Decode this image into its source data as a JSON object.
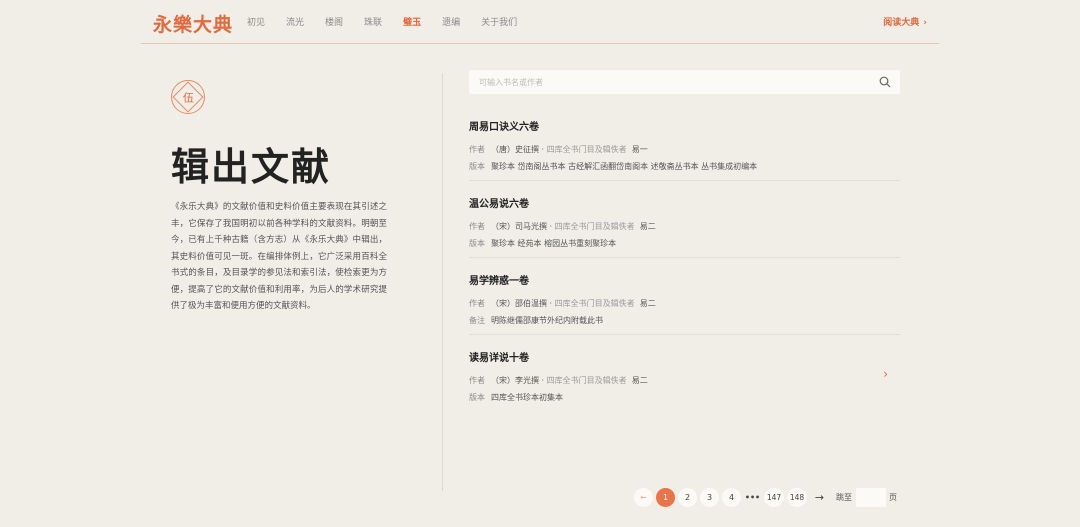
{
  "header": {
    "logo": "永樂大典",
    "nav": [
      "初见",
      "流光",
      "楼阁",
      "珠联",
      "璧玉",
      "遗编",
      "关于我们"
    ],
    "active_index": 4,
    "read_link": "阅读大典",
    "read_chevron": "›"
  },
  "section": {
    "seal": "伍",
    "title": "辑出文献",
    "intro": "《永乐大典》的文献价值和史料价值主要表现在其引述之丰，它保存了我国明初以前各种学科的文献资料。明朝至今，已有上千种古籍（含方志）从《永乐大典》中辑出，其史料价值可见一斑。在编排体例上，它广泛采用百科全书式的条目，及目录学的参见法和索引法，使检索更为方便，提高了它的文献价值和利用率，为后人的学术研究提供了极为丰富和便用方便的文献资料。"
  },
  "search": {
    "placeholder": "可输入书名或作者"
  },
  "books": [
    {
      "title": "周易口诀义六卷",
      "author_label": "作者",
      "author": "（唐）史征撰",
      "source": "四库全书门目及辑佚者",
      "source_value": "易一",
      "extra_label": "版本",
      "extra": "聚珍本  岱南阁丛书本  古经解汇函翻岱南阁本  述敬斋丛书本  丛书集成初编本"
    },
    {
      "title": "温公易说六卷",
      "author_label": "作者",
      "author": "（宋）司马光撰",
      "source": "四库全书门目及辑佚者",
      "source_value": "易二",
      "extra_label": "版本",
      "extra": "聚珍本  经苑本  榕园丛书重刻聚珍本"
    },
    {
      "title": "易学辨惑一卷",
      "author_label": "作者",
      "author": "（宋）邵伯温撰",
      "source": "四库全书门目及辑佚者",
      "source_value": "易二",
      "extra_label": "备注",
      "extra": "明陈继儒邵康节外纪内附载此书"
    },
    {
      "title": "读易详说十卷",
      "author_label": "作者",
      "author": "（宋）李光撰",
      "source": "四库全书门目及辑佚者",
      "source_value": "易二",
      "extra_label": "版本",
      "extra": "四库全书珍本初集本",
      "arrow": "›"
    }
  ],
  "pagination": {
    "prev": "←",
    "pages": [
      "1",
      "2",
      "3",
      "4"
    ],
    "dots": "•••",
    "tail": [
      "147",
      "148"
    ],
    "next": "→",
    "current": "1",
    "goto_label": "跳至",
    "goto_suffix": "页"
  },
  "colors": {
    "accent": "#e26a3f",
    "background": "#f1eee8"
  }
}
